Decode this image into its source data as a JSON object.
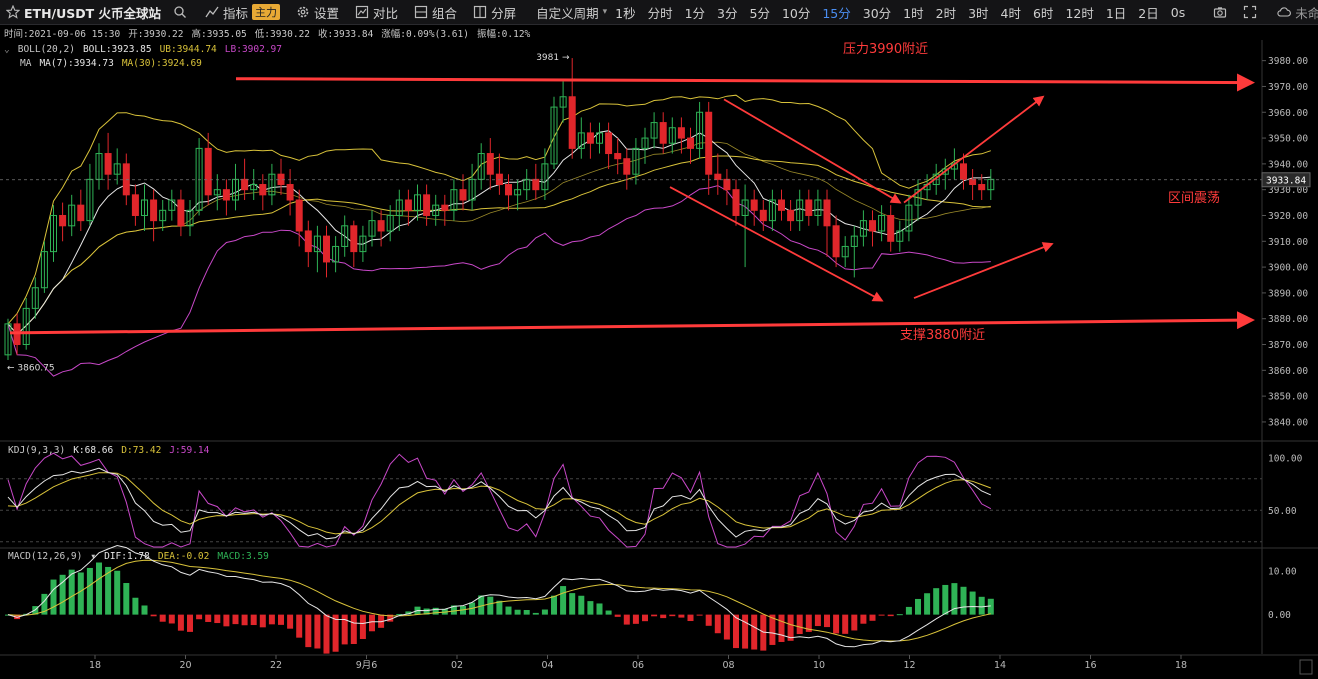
{
  "toolbar": {
    "symbol": "ETH/USDT 火币全球站",
    "indicators_label": "指标",
    "main_badge": "主力",
    "settings_label": "设置",
    "compare_label": "对比",
    "combo_label": "组合",
    "split_label": "分屏",
    "custom_period_label": "自定义周期",
    "periods": [
      "1秒",
      "分时",
      "1分",
      "3分",
      "5分",
      "10分",
      "15分",
      "30分",
      "1时",
      "2时",
      "3时",
      "4时",
      "6时",
      "12时",
      "1日",
      "2日"
    ],
    "active_period": "15分",
    "latency": "0s",
    "account_label": "未命名"
  },
  "info": {
    "time": "时间:2021-09-06 15:30",
    "open": "开:3930.22",
    "high": "高:3935.05",
    "low": "低:3930.22",
    "close": "收:3933.84",
    "change": "涨幅:0.09%(3.61)",
    "amplitude": "振幅:0.12%"
  },
  "boll": {
    "name": "BOLL(20,2)",
    "mid": "BOLL:3923.85",
    "ub": "UB:3944.74",
    "lb": "LB:3902.97"
  },
  "ma": {
    "name": "MA",
    "ma7": "MA(7):3934.73",
    "ma30": "MA(30):3924.69"
  },
  "kdj": {
    "name": "KDJ(9,3,3)",
    "k": "K:68.66",
    "d": "D:73.42",
    "j": "J:59.14"
  },
  "macd": {
    "name": "MACD(12,26,9)",
    "dif": "DIF:1.78",
    "dea": "DEA:-0.02",
    "macd": "MACD:3.59"
  },
  "colors": {
    "up": "#2fb356",
    "down": "#e0262b",
    "ma7": "#e6e6e6",
    "ma30": "#d8c23a",
    "boll_bands": "#d8c23a",
    "boll_lb": "#c848c8",
    "kdj_k": "#e6e6e6",
    "kdj_d": "#d8c23a",
    "kdj_j": "#c848c8",
    "annotation": "#ff3b3b",
    "active_period": "#4a8df0",
    "price_tag": "#2a2a2a"
  },
  "chart_data": {
    "type": "candlestick",
    "interval": "15分",
    "current_price_label": "3933.84",
    "price_axis_ticks": [
      "3980.00",
      "3970.00",
      "3960.00",
      "3950.00",
      "3940.00",
      "3930.00",
      "3920.00",
      "3910.00",
      "3900.00",
      "3890.00",
      "3880.00",
      "3870.00",
      "3860.00",
      "3850.00",
      "3840.00"
    ],
    "price_range": [
      3833,
      3988
    ],
    "kdj_axis_ticks": [
      "100.00",
      "50.00"
    ],
    "kdj_range": [
      15,
      115
    ],
    "macd_axis_ticks": [
      "10.00",
      "0.00"
    ],
    "macd_range": [
      -9,
      15
    ],
    "x_axis_labels": [
      "18",
      "20",
      "22",
      "9月6",
      "02",
      "04",
      "06",
      "08",
      "10",
      "12",
      "14",
      "16",
      "18"
    ],
    "high_marker": "3981",
    "low_marker": "3860.75",
    "annotations": [
      {
        "text": "压力3990附近"
      },
      {
        "text": "支撑3880附近"
      },
      {
        "text": "区间震荡"
      }
    ],
    "candles": [
      [
        3866,
        3878,
        3864,
        3880
      ],
      [
        3878,
        3870,
        3866,
        3882
      ],
      [
        3870,
        3884,
        3868,
        3888
      ],
      [
        3884,
        3892,
        3880,
        3896
      ],
      [
        3892,
        3906,
        3890,
        3910
      ],
      [
        3906,
        3920,
        3902,
        3924
      ],
      [
        3920,
        3916,
        3910,
        3925
      ],
      [
        3916,
        3924,
        3912,
        3928
      ],
      [
        3924,
        3918,
        3914,
        3930
      ],
      [
        3918,
        3934,
        3916,
        3940
      ],
      [
        3934,
        3944,
        3930,
        3948
      ],
      [
        3944,
        3936,
        3930,
        3952
      ],
      [
        3936,
        3940,
        3932,
        3946
      ],
      [
        3940,
        3928,
        3924,
        3944
      ],
      [
        3928,
        3920,
        3916,
        3932
      ],
      [
        3920,
        3926,
        3914,
        3932
      ],
      [
        3926,
        3918,
        3910,
        3930
      ],
      [
        3918,
        3922,
        3914,
        3926
      ],
      [
        3922,
        3926,
        3918,
        3930
      ],
      [
        3926,
        3916,
        3912,
        3930
      ],
      [
        3916,
        3922,
        3912,
        3926
      ],
      [
        3922,
        3946,
        3920,
        3950
      ],
      [
        3946,
        3928,
        3924,
        3952
      ],
      [
        3928,
        3930,
        3922,
        3936
      ],
      [
        3930,
        3926,
        3920,
        3934
      ],
      [
        3926,
        3934,
        3922,
        3940
      ],
      [
        3934,
        3930,
        3926,
        3942
      ],
      [
        3930,
        3932,
        3926,
        3938
      ],
      [
        3932,
        3928,
        3922,
        3936
      ],
      [
        3928,
        3936,
        3924,
        3940
      ],
      [
        3936,
        3932,
        3928,
        3942
      ],
      [
        3932,
        3926,
        3920,
        3938
      ],
      [
        3926,
        3914,
        3908,
        3930
      ],
      [
        3914,
        3906,
        3900,
        3918
      ],
      [
        3906,
        3912,
        3898,
        3916
      ],
      [
        3912,
        3902,
        3896,
        3916
      ],
      [
        3902,
        3908,
        3898,
        3912
      ],
      [
        3908,
        3916,
        3904,
        3920
      ],
      [
        3916,
        3906,
        3900,
        3918
      ],
      [
        3906,
        3912,
        3902,
        3916
      ],
      [
        3912,
        3918,
        3908,
        3922
      ],
      [
        3918,
        3914,
        3908,
        3922
      ],
      [
        3914,
        3920,
        3910,
        3924
      ],
      [
        3920,
        3926,
        3914,
        3930
      ],
      [
        3926,
        3922,
        3916,
        3930
      ],
      [
        3922,
        3928,
        3918,
        3932
      ],
      [
        3928,
        3920,
        3916,
        3932
      ],
      [
        3920,
        3924,
        3916,
        3928
      ],
      [
        3924,
        3922,
        3916,
        3928
      ],
      [
        3922,
        3930,
        3918,
        3934
      ],
      [
        3930,
        3926,
        3922,
        3936
      ],
      [
        3926,
        3934,
        3922,
        3940
      ],
      [
        3934,
        3944,
        3930,
        3948
      ],
      [
        3944,
        3936,
        3930,
        3950
      ],
      [
        3936,
        3932,
        3928,
        3944
      ],
      [
        3932,
        3928,
        3922,
        3936
      ],
      [
        3928,
        3930,
        3922,
        3934
      ],
      [
        3930,
        3934,
        3926,
        3938
      ],
      [
        3934,
        3930,
        3926,
        3940
      ],
      [
        3930,
        3940,
        3926,
        3946
      ],
      [
        3940,
        3962,
        3938,
        3966
      ],
      [
        3962,
        3966,
        3956,
        3972
      ],
      [
        3966,
        3946,
        3942,
        3981
      ],
      [
        3946,
        3952,
        3942,
        3958
      ],
      [
        3952,
        3948,
        3942,
        3956
      ],
      [
        3948,
        3952,
        3944,
        3956
      ],
      [
        3952,
        3944,
        3938,
        3956
      ],
      [
        3944,
        3942,
        3936,
        3950
      ],
      [
        3942,
        3936,
        3930,
        3946
      ],
      [
        3936,
        3946,
        3932,
        3950
      ],
      [
        3946,
        3950,
        3940,
        3954
      ],
      [
        3950,
        3956,
        3946,
        3960
      ],
      [
        3956,
        3948,
        3944,
        3960
      ],
      [
        3948,
        3954,
        3944,
        3958
      ],
      [
        3954,
        3950,
        3944,
        3958
      ],
      [
        3950,
        3946,
        3940,
        3954
      ],
      [
        3946,
        3960,
        3942,
        3964
      ],
      [
        3960,
        3936,
        3928,
        3964
      ],
      [
        3936,
        3934,
        3928,
        3944
      ],
      [
        3934,
        3930,
        3924,
        3938
      ],
      [
        3930,
        3920,
        3916,
        3934
      ],
      [
        3920,
        3926,
        3900,
        3932
      ],
      [
        3926,
        3922,
        3916,
        3930
      ],
      [
        3922,
        3918,
        3914,
        3926
      ],
      [
        3918,
        3926,
        3914,
        3930
      ],
      [
        3926,
        3922,
        3918,
        3930
      ],
      [
        3922,
        3918,
        3914,
        3926
      ],
      [
        3918,
        3926,
        3914,
        3930
      ],
      [
        3926,
        3920,
        3916,
        3930
      ],
      [
        3920,
        3926,
        3916,
        3930
      ],
      [
        3926,
        3916,
        3904,
        3930
      ],
      [
        3916,
        3904,
        3900,
        3920
      ],
      [
        3904,
        3908,
        3900,
        3912
      ],
      [
        3908,
        3912,
        3896,
        3916
      ],
      [
        3912,
        3918,
        3908,
        3922
      ],
      [
        3918,
        3914,
        3908,
        3922
      ],
      [
        3914,
        3920,
        3910,
        3924
      ],
      [
        3920,
        3910,
        3906,
        3924
      ],
      [
        3910,
        3914,
        3906,
        3918
      ],
      [
        3914,
        3924,
        3910,
        3928
      ],
      [
        3924,
        3930,
        3918,
        3934
      ],
      [
        3930,
        3932,
        3926,
        3936
      ],
      [
        3932,
        3936,
        3928,
        3940
      ],
      [
        3936,
        3938,
        3930,
        3942
      ],
      [
        3938,
        3940,
        3934,
        3946
      ],
      [
        3940,
        3934,
        3930,
        3944
      ],
      [
        3934,
        3932,
        3926,
        3938
      ],
      [
        3932,
        3930,
        3926,
        3936
      ],
      [
        3930,
        3934,
        3926,
        3938
      ]
    ]
  }
}
